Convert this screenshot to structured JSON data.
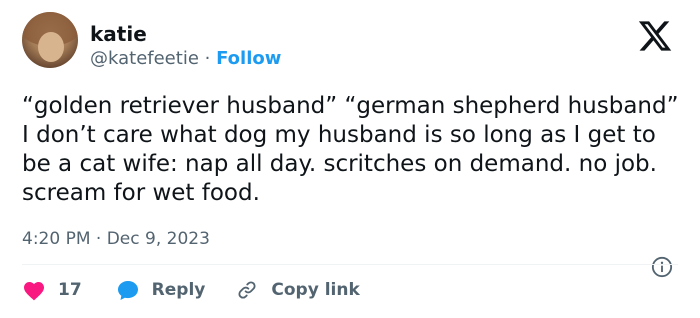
{
  "author": {
    "name": "katie",
    "handle": "@katefeetie",
    "separator": "·",
    "follow_label": "Follow"
  },
  "tweet": {
    "text": "“golden retriever husband” “german shepherd husband” I don’t care what dog my husband is so long as I get to be a cat wife: nap all day. scritches on demand. no job. scream for wet food.",
    "time": "4:20 PM",
    "date_separator": "·",
    "date": "Dec 9, 2023"
  },
  "actions": {
    "like_count": "17",
    "reply_label": "Reply",
    "copy_link_label": "Copy link"
  },
  "colors": {
    "accent": "#1d9bf0",
    "like": "#f91880",
    "text": "#0f1419",
    "muted": "#536471"
  },
  "icons": {
    "logo": "x-logo-icon",
    "info": "info-icon",
    "like": "heart-icon",
    "reply": "speech-bubble-icon",
    "copy_link": "link-icon"
  }
}
